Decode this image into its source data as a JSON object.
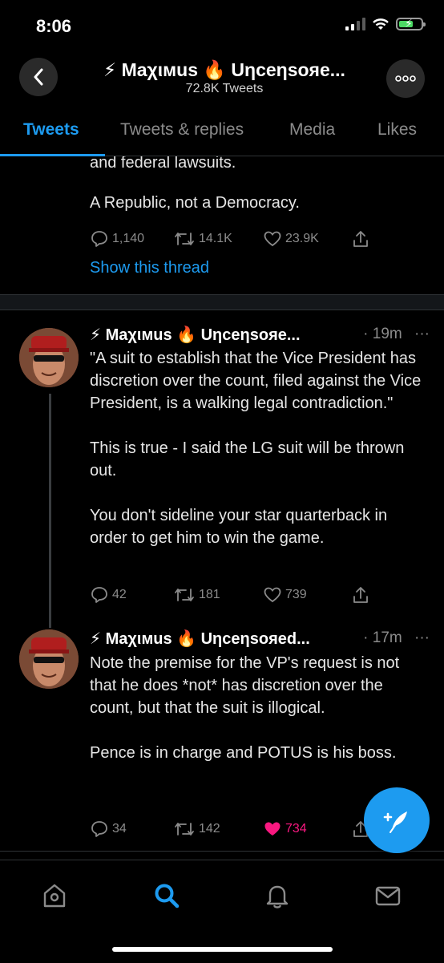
{
  "status_bar": {
    "time": "8:06"
  },
  "header": {
    "title": "⚡ Maχιмus 🔥 Uηceηsoяe...",
    "subtitle": "72.8K Tweets",
    "back_icon": "chevron-left-icon",
    "more_icon": "ellipsis-icon",
    "more_label": "ooo"
  },
  "tabs": [
    {
      "label": "Tweets",
      "active": true
    },
    {
      "label": "Tweets & replies",
      "active": false
    },
    {
      "label": "Media",
      "active": false
    },
    {
      "label": "Likes",
      "active": false
    }
  ],
  "previous_tweet": {
    "text_line_1": "and federal lawsuits.",
    "text_line_2": "A Republic, not a Democracy.",
    "replies": "1,140",
    "retweets": "14.1K",
    "likes": "23.9K",
    "show_thread": "Show this thread"
  },
  "tweets": [
    {
      "name": "⚡ Maχιмus 🔥 Uηceηsoяe...",
      "time": "· 19m",
      "more": "···",
      "paragraphs": [
        "\"A suit to establish that the Vice President has discretion over the count, filed against the Vice President, is a walking legal contradiction.\"",
        "This is true - I said the LG suit will be thrown out.",
        "You don't sideline your star quarterback in order to get him to win the game."
      ],
      "replies": "42",
      "retweets": "181",
      "likes": "739",
      "liked": false
    },
    {
      "name": "⚡ Maχιмus 🔥 Uηceηsoяed...",
      "time": "· 17m",
      "more": "···",
      "paragraphs": [
        "Note the premise for the VP's request is not that he does *not* has discretion over the count, but that the suit is illogical.",
        "Pence is in charge and POTUS is his boss."
      ],
      "replies": "34",
      "retweets": "142",
      "likes": "734",
      "liked": true
    }
  ],
  "fab": {
    "icon": "compose-feather-icon"
  },
  "bottom_nav": [
    {
      "icon": "home-icon"
    },
    {
      "icon": "search-icon",
      "active": true
    },
    {
      "icon": "bell-icon"
    },
    {
      "icon": "mail-icon"
    }
  ],
  "colors": {
    "accent": "#1d9bf0",
    "like": "#f91880",
    "background": "#000000"
  }
}
